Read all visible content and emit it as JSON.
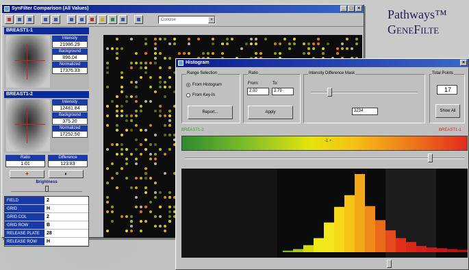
{
  "brand": {
    "line1": "Pathways™",
    "line2": "GeneFilte"
  },
  "main_window": {
    "title": "SynFilter Comparison (All Values)",
    "combo_value": "Concise",
    "spot1": {
      "name": "BREAST1-1",
      "intensity_label": "Intensity",
      "intensity": "21986.29",
      "background_label": "Background",
      "background": "896.04",
      "normalized_label": "Normalized",
      "normalized": "17376.33"
    },
    "spot2": {
      "name": "BREAST1-2",
      "intensity_label": "Intensity",
      "intensity": "12481.84",
      "background_label": "Background",
      "background": "375.20",
      "normalized_label": "Normalized",
      "normalized": "17252.50"
    },
    "ratio_label": "Ratio",
    "ratio": "1.01",
    "difference_label": "Difference",
    "difference": "123.83",
    "brightness_label": "Brightness",
    "fields": [
      {
        "key": "FIELD",
        "value": "2"
      },
      {
        "key": "GRID",
        "value": "H"
      },
      {
        "key": "GRID COL",
        "value": "2"
      },
      {
        "key": "GRID ROW",
        "value": "B"
      },
      {
        "key": "RELEASE PLATE",
        "value": "28"
      },
      {
        "key": "RELEASE ROW",
        "value": "H"
      }
    ]
  },
  "histogram_window": {
    "title": "Histogram",
    "range_selection_label": "Range Selection",
    "from_histogram": "From Histogram",
    "from_keyin": "From Key-In",
    "report_button": "Report...",
    "ratio_label": "Ratio",
    "from_label": "From:",
    "to_label": "To:",
    "from_value": "2.00",
    "to_value": "2.79",
    "apply_button": "Apply",
    "intensity_mask_label": "Intensity Difference Mask",
    "mask_value": "3234",
    "total_points_label": "Total Points",
    "total_points": "17",
    "show_all_button": "Show All",
    "left_sample": "BREAST1-2",
    "right_sample": "BREAST1-1",
    "center_marker": "-1 +",
    "bars": [
      2,
      4,
      9,
      18,
      38,
      58,
      73,
      100,
      59,
      41,
      28,
      18,
      13,
      8,
      6,
      5,
      4,
      3,
      2,
      2
    ],
    "colors": {
      "accent": "#0a1a8c",
      "label_blue": "#1a3aa8"
    }
  }
}
